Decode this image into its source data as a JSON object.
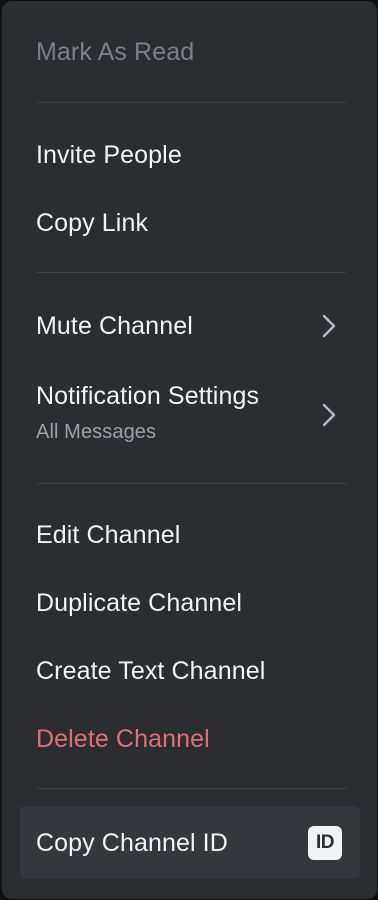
{
  "menu": {
    "mark_as_read": "Mark As Read",
    "invite_people": "Invite People",
    "copy_link": "Copy Link",
    "mute_channel": "Mute Channel",
    "notification_settings": "Notification Settings",
    "notification_settings_value": "All Messages",
    "edit_channel": "Edit Channel",
    "duplicate_channel": "Duplicate Channel",
    "create_text_channel": "Create Text Channel",
    "delete_channel": "Delete Channel",
    "copy_channel_id": "Copy Channel ID",
    "id_badge": "ID"
  },
  "colors": {
    "background": "#2b2d31",
    "text": "#f2f3f5",
    "disabled_text": "#7d7f86",
    "danger_text": "#e0706f",
    "secondary_text": "#9ea0a6",
    "separator": "#3f4147",
    "hover": "#36373d"
  },
  "icons": {
    "submenu": "chevron-right-icon",
    "id": "id-badge-icon"
  }
}
